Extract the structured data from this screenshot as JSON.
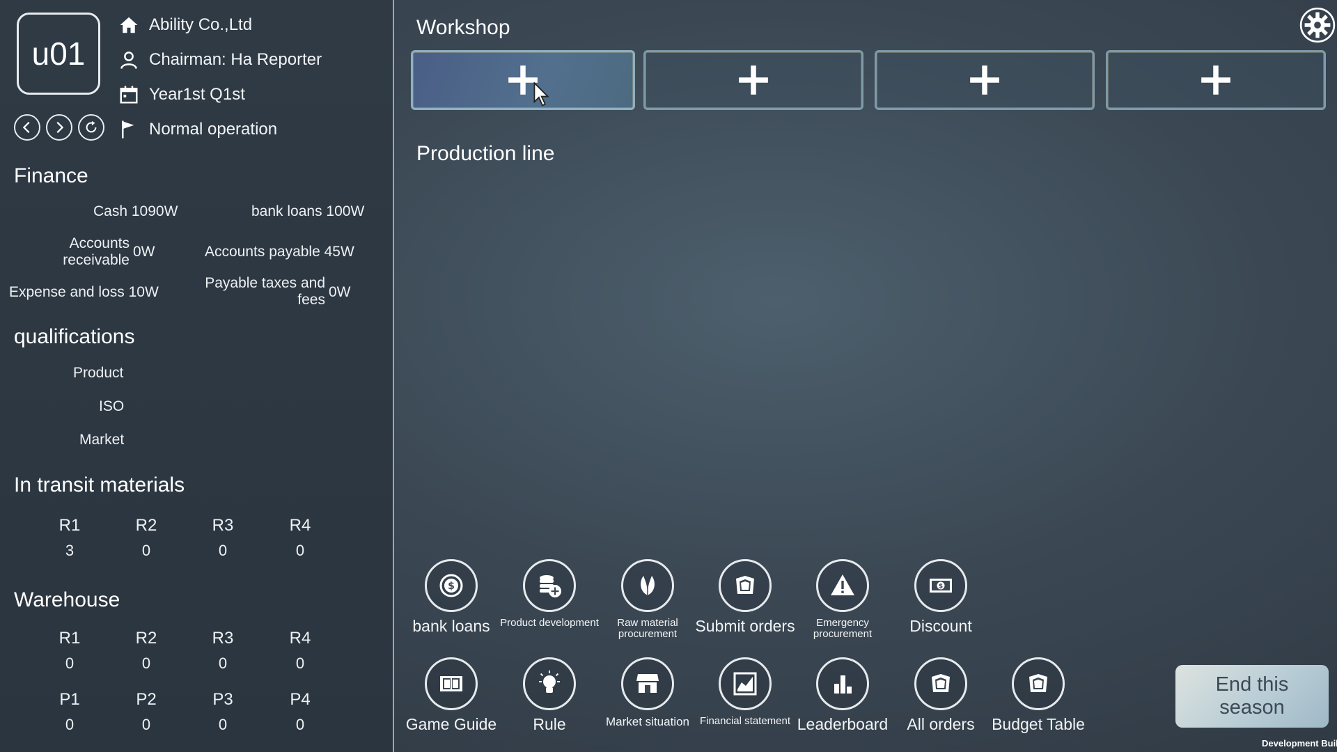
{
  "header": {
    "avatar_text": "u01",
    "company": "Ability Co.,Ltd",
    "chairman": "Chairman:  Ha Reporter",
    "period": "Year1st  Q1st",
    "status": "Normal operation"
  },
  "finance": {
    "title": "Finance",
    "cash": "Cash 1090W",
    "bank_loans": "bank loans 100W",
    "accounts_receivable_label_1": "Accounts",
    "accounts_receivable_label_2": "receivable",
    "accounts_receivable_value": "0W",
    "accounts_payable": "Accounts payable 45W",
    "expense_loss": "Expense and loss 10W",
    "payable_taxes_label_1": "Payable taxes and",
    "payable_taxes_label_2": "fees",
    "payable_taxes_value": "0W"
  },
  "qualifications": {
    "title": "qualifications",
    "product": "Product",
    "iso": "ISO",
    "market": "Market"
  },
  "in_transit": {
    "title": "In transit materials",
    "headers": [
      "R1",
      "R2",
      "R3",
      "R4"
    ],
    "values": [
      "3",
      "0",
      "0",
      "0"
    ]
  },
  "warehouse": {
    "title": "Warehouse",
    "r_headers": [
      "R1",
      "R2",
      "R3",
      "R4"
    ],
    "r_values": [
      "0",
      "0",
      "0",
      "0"
    ],
    "p_headers": [
      "P1",
      "P2",
      "P3",
      "P4"
    ],
    "p_values": [
      "0",
      "0",
      "0",
      "0"
    ]
  },
  "main": {
    "workshop_title": "Workshop",
    "production_line_title": "Production line"
  },
  "actions_row1": [
    {
      "label": "bank loans",
      "icon": "dollar-coin-icon"
    },
    {
      "label": "Product development",
      "icon": "coins-plus-icon"
    },
    {
      "label": "Raw material procurement",
      "icon": "leaf-icon"
    },
    {
      "label": "Submit orders",
      "icon": "notes-icon"
    },
    {
      "label": "Emergency procurement",
      "icon": "warning-icon"
    },
    {
      "label": "Discount",
      "icon": "banknote-icon"
    }
  ],
  "actions_row2": [
    {
      "label": "Game Guide",
      "icon": "book-icon"
    },
    {
      "label": "Rule",
      "icon": "lightbulb-icon"
    },
    {
      "label": "Market situation",
      "icon": "store-icon"
    },
    {
      "label": "Financial statement",
      "icon": "chart-icon"
    },
    {
      "label": "Leaderboard",
      "icon": "bar-chart-icon"
    },
    {
      "label": "All orders",
      "icon": "notes-icon"
    },
    {
      "label": "Budget Table",
      "icon": "notes-icon"
    }
  ],
  "end_season": "End this\nseason",
  "dev_build": "Development Build"
}
